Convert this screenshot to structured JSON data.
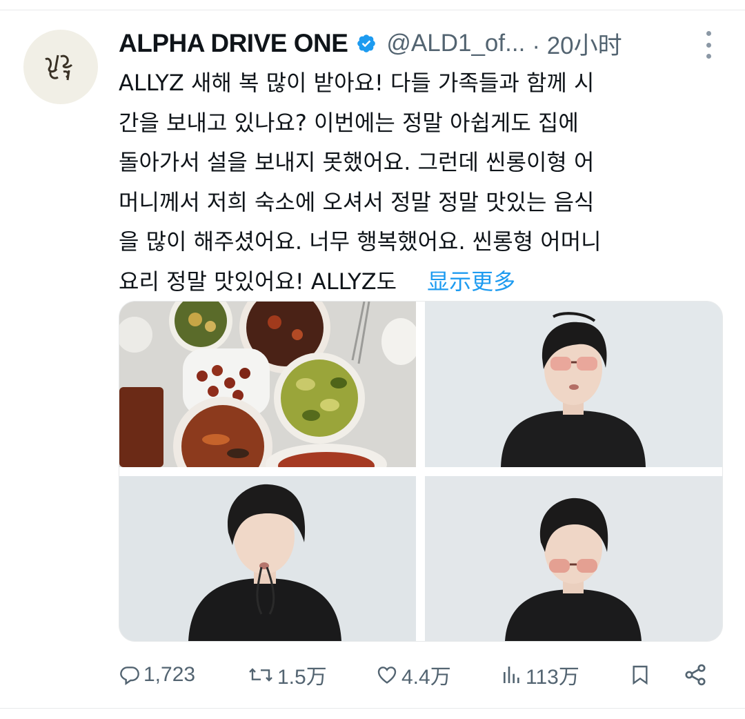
{
  "tweet": {
    "author": {
      "display_name": "ALPHA DRIVE ONE",
      "handle": "@ALD1_of...",
      "verified": true,
      "avatar_logo": "ALD1 logo"
    },
    "time": "· 20小时",
    "text_lines": [
      "ALLYZ 새해 복 많이 받아요! 다들 가족들과 함께 시",
      "간을 보내고 있나요? 이번에는 정말 아쉽게도 집에",
      "돌아가서 설을 보내지 못했어요. 그런데 씬롱이형 어",
      "머니께서 저희 숙소에 오셔서 정말 정말 맛있는 음식",
      "을 많이 해주셨어요. 너무 행복했어요. 씬롱형 어머니",
      "요리 정말 맛있어요! ALLYZ도"
    ],
    "show_more": "显示更多",
    "media": [
      {
        "icon": "food-table-photo"
      },
      {
        "icon": "person-with-sunglasses-photo"
      },
      {
        "icon": "person-holding-glasses-photo"
      },
      {
        "icon": "person-glasses-lowered-photo"
      }
    ],
    "actions": {
      "replies": "1,723",
      "retweets": "1.5万",
      "likes": "4.4万",
      "views": "113万"
    }
  },
  "colors": {
    "text": "#0f1419",
    "secondary": "#536471",
    "link": "#1d9bf0",
    "verified": "#1d9bf0"
  }
}
